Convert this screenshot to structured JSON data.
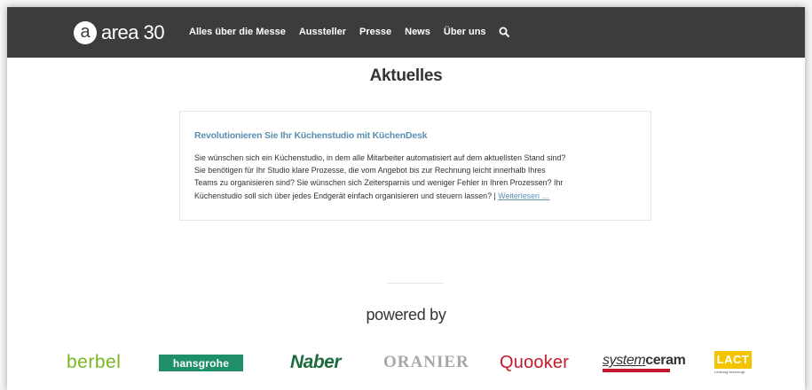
{
  "header": {
    "logo_letter": "a",
    "logo_text": "area 30",
    "nav": [
      {
        "label": "Alles über die Messe"
      },
      {
        "label": "Aussteller"
      },
      {
        "label": "Presse"
      },
      {
        "label": "News"
      },
      {
        "label": "Über uns"
      }
    ],
    "search_icon": "search-icon"
  },
  "main": {
    "section_title": "Aktuelles",
    "article": {
      "title": "Revolutionieren Sie Ihr Küchenstudio mit KüchenDesk",
      "lines": [
        "Sie wünschen sich ein Küchenstudio, in dem alle Mitarbeiter automatisiert auf dem aktuellsten Stand sind?",
        "Sie benötigen für Ihr Studio klare Prozesse, die vom Angebot bis zur Rechnung leicht innerhalb Ihres",
        "Teams zu organisieren sind? Sie wünschen sich Zeitersparnis und weniger Fehler in Ihren Prozessen? Ihr",
        "Küchenstudio soll sich über jedes Endgerät einfach organisieren und steuern lassen? |"
      ],
      "more_label": "Weiterlesen …"
    },
    "powered_by": "powered by"
  },
  "sponsors": {
    "berbel": "berbel",
    "hansgrohe": "hansgrohe",
    "naber": "Naber",
    "oranier": "ORANIER",
    "quooker": "Quooker",
    "systemceram_a": "system",
    "systemceram_b": "ceram",
    "lact": "LACT",
    "lact_sub": "Leistung überzeugt"
  },
  "colors": {
    "header_bg": "#3c3c3b",
    "link": "#5b8fb0",
    "berbel": "#7ab51d",
    "hansgrohe": "#1f8f6a",
    "naber": "#1c6b3c",
    "quooker": "#c5182c"
  }
}
